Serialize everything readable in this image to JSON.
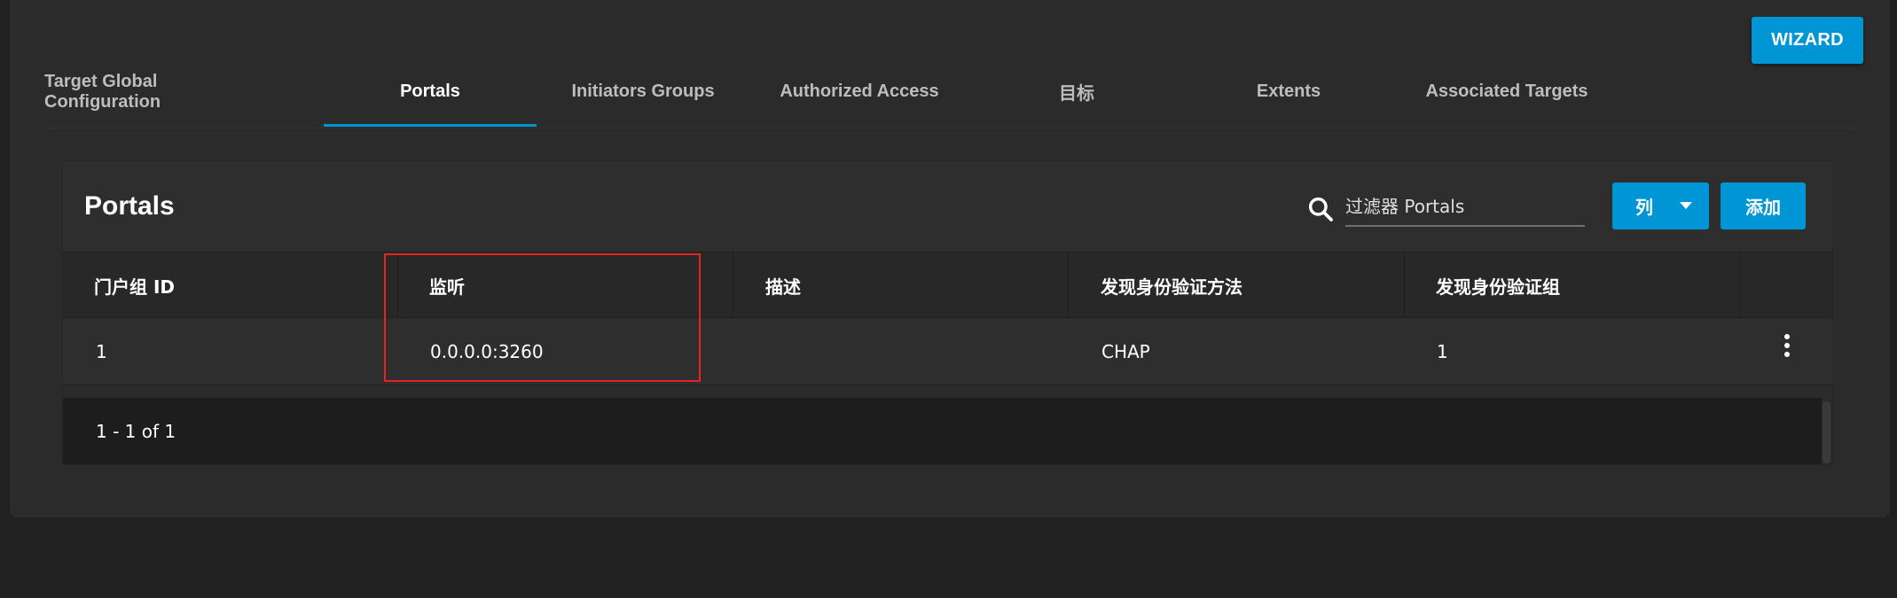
{
  "wizard_label": "WIZARD",
  "tabs": [
    {
      "label": "Target Global Configuration",
      "active": false
    },
    {
      "label": "Portals",
      "active": true
    },
    {
      "label": "Initiators Groups",
      "active": false
    },
    {
      "label": "Authorized Access",
      "active": false
    },
    {
      "label": "目标",
      "active": false
    },
    {
      "label": "Extents",
      "active": false
    },
    {
      "label": "Associated Targets",
      "active": false
    }
  ],
  "card": {
    "title": "Portals",
    "search_placeholder": "过滤器 Portals",
    "columns_label": "列",
    "add_label": "添加"
  },
  "table": {
    "headers": [
      "门户组 ID",
      "监听",
      "描述",
      "发现身份验证方法",
      "发现身份验证组"
    ],
    "rows": [
      [
        "1",
        "0.0.0.0:3260",
        "",
        "CHAP",
        "1"
      ]
    ],
    "footer": "1 - 1 of 1"
  },
  "icons": [
    "search-icon",
    "caret-down-icon",
    "more-vert-icon"
  ],
  "colors": {
    "accent": "#0095d5",
    "highlight": "#e52320",
    "background": "#212121",
    "card": "#2b2b2b"
  }
}
